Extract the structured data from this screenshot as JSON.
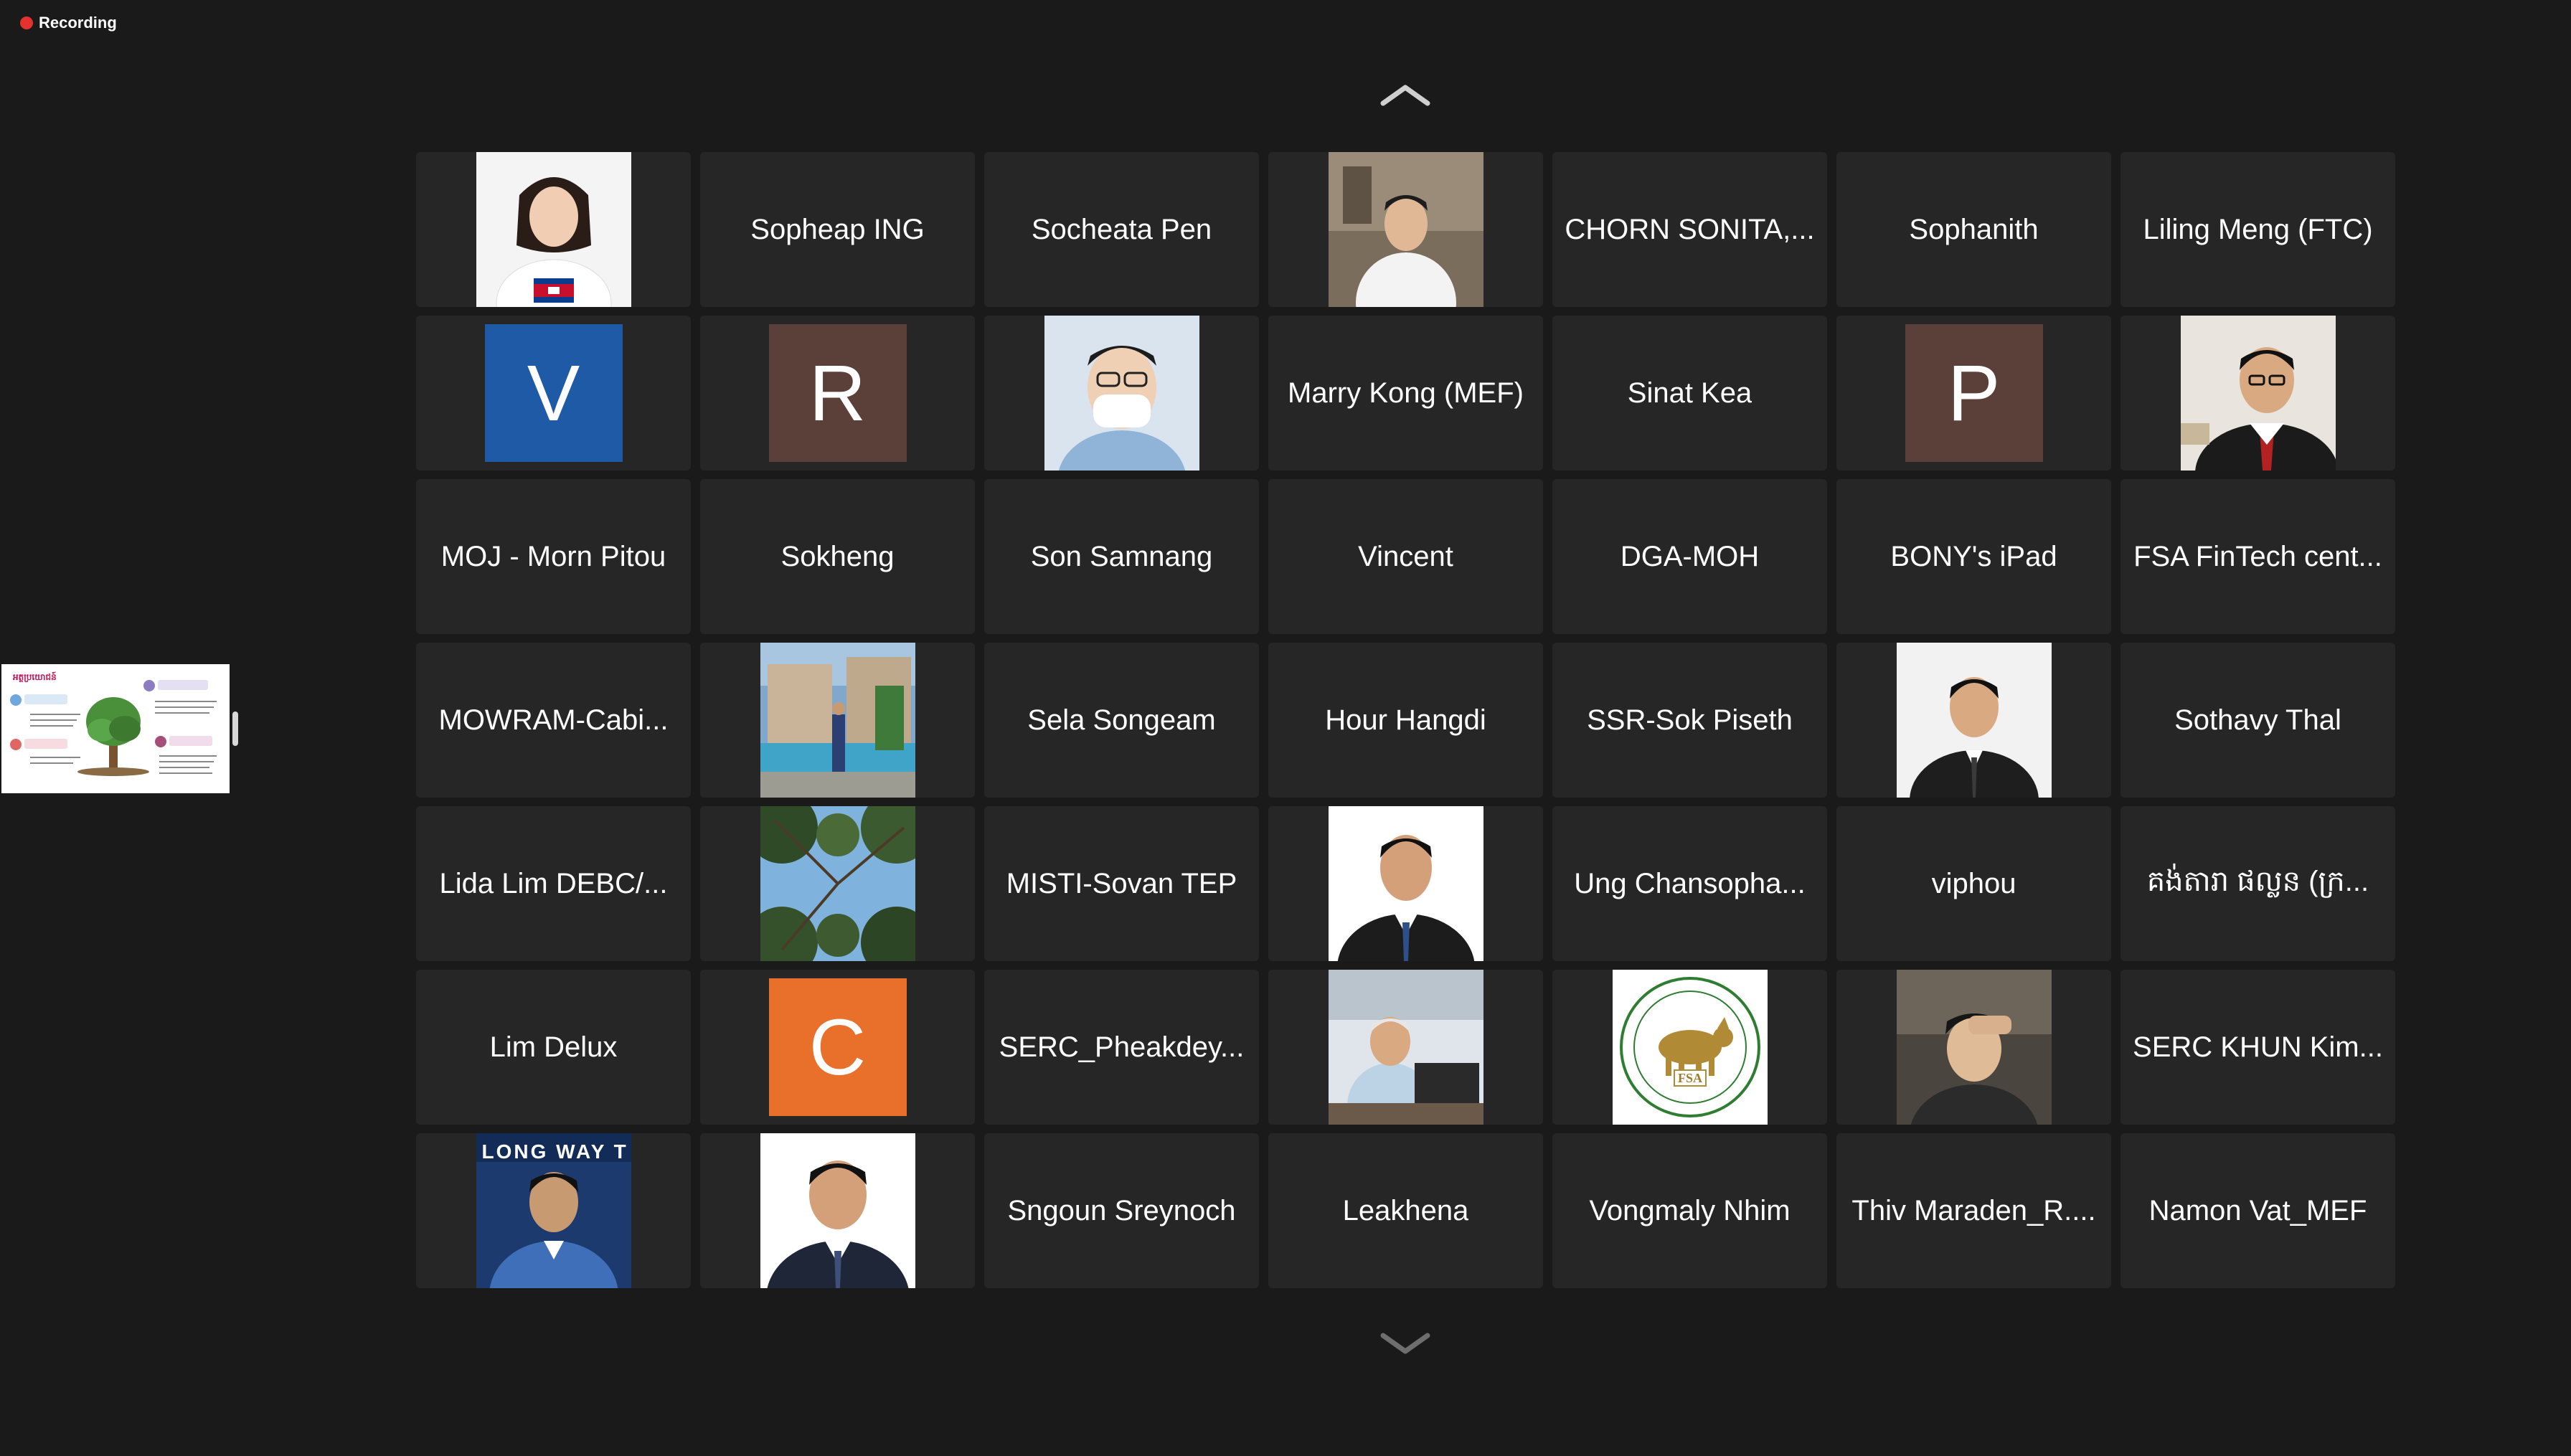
{
  "recording": {
    "label": "Recording",
    "dot_color": "#e5322d"
  },
  "navigation": {
    "up_icon": "chevron-up-icon",
    "down_icon": "chevron-down-icon"
  },
  "participants": [
    {
      "id": "p01",
      "type": "photo",
      "name": "",
      "photo": "woman-with-cambodian-flag"
    },
    {
      "id": "p02",
      "type": "name",
      "name": "Sopheap ING"
    },
    {
      "id": "p03",
      "type": "name",
      "name": "Socheata Pen"
    },
    {
      "id": "p04",
      "type": "photo",
      "name": "",
      "photo": "man-in-white-shirt"
    },
    {
      "id": "p05",
      "type": "name",
      "name": "CHORN SONITA,..."
    },
    {
      "id": "p06",
      "type": "name",
      "name": "Sophanith"
    },
    {
      "id": "p07",
      "type": "name",
      "name": "Liling Meng (FTC)"
    },
    {
      "id": "p08",
      "type": "avatar",
      "letter": "V",
      "color": "#1f5aa6"
    },
    {
      "id": "p09",
      "type": "avatar",
      "letter": "R",
      "color": "#5a4038"
    },
    {
      "id": "p10",
      "type": "photo",
      "name": "",
      "photo": "man-with-mask"
    },
    {
      "id": "p11",
      "type": "name",
      "name": "Marry Kong (MEF)"
    },
    {
      "id": "p12",
      "type": "name",
      "name": "Sinat Kea"
    },
    {
      "id": "p13",
      "type": "avatar",
      "letter": "P",
      "color": "#5a4038"
    },
    {
      "id": "p14",
      "type": "photo",
      "name": "",
      "photo": "man-with-glasses-suit"
    },
    {
      "id": "p15",
      "type": "name",
      "name": "MOJ - Morn Pitou"
    },
    {
      "id": "p16",
      "type": "name",
      "name": "Sokheng"
    },
    {
      "id": "p17",
      "type": "name",
      "name": "Son Samnang"
    },
    {
      "id": "p18",
      "type": "name",
      "name": "Vincent"
    },
    {
      "id": "p19",
      "type": "name",
      "name": "DGA-MOH"
    },
    {
      "id": "p20",
      "type": "name",
      "name": "BONY's iPad"
    },
    {
      "id": "p21",
      "type": "name",
      "name": "FSA FinTech cent..."
    },
    {
      "id": "p22",
      "type": "name",
      "name": "MOWRAM-Cabi..."
    },
    {
      "id": "p23",
      "type": "photo",
      "name": "",
      "photo": "man-by-pool"
    },
    {
      "id": "p24",
      "type": "name",
      "name": "Sela Songeam"
    },
    {
      "id": "p25",
      "type": "name",
      "name": "Hour Hangdi"
    },
    {
      "id": "p26",
      "type": "name",
      "name": "SSR-Sok Piseth"
    },
    {
      "id": "p27",
      "type": "photo",
      "name": "",
      "photo": "man-in-suit-portrait"
    },
    {
      "id": "p28",
      "type": "name",
      "name": "Sothavy Thal"
    },
    {
      "id": "p29",
      "type": "name",
      "name": "Lida Lim DEBC/..."
    },
    {
      "id": "p30",
      "type": "photo",
      "name": "",
      "photo": "tree-canopy"
    },
    {
      "id": "p31",
      "type": "name",
      "name": "MISTI-Sovan TEP"
    },
    {
      "id": "p32",
      "type": "photo",
      "name": "",
      "photo": "man-suit-blue-tie"
    },
    {
      "id": "p33",
      "type": "name",
      "name": "Ung Chansopha..."
    },
    {
      "id": "p34",
      "type": "name",
      "name": "viphou"
    },
    {
      "id": "p35",
      "type": "name",
      "name": "គង់តារា ផល្លន (ក្រ..."
    },
    {
      "id": "p36",
      "type": "name",
      "name": "Lim Delux"
    },
    {
      "id": "p37",
      "type": "avatar",
      "letter": "C",
      "color": "#e8702a"
    },
    {
      "id": "p38",
      "type": "name",
      "name": "SERC_Pheakdey..."
    },
    {
      "id": "p39",
      "type": "photo",
      "name": "",
      "photo": "man-at-desk"
    },
    {
      "id": "p40",
      "type": "photo",
      "name": "",
      "photo": "fsa-logo",
      "logo_text": "FSA"
    },
    {
      "id": "p41",
      "type": "photo",
      "name": "",
      "photo": "young-man-selfie"
    },
    {
      "id": "p42",
      "type": "name",
      "name": "SERC KHUN Kim..."
    },
    {
      "id": "p43",
      "type": "photo",
      "name": "",
      "photo": "man-blue-suit-banner",
      "banner_text": "LONG WAY T"
    },
    {
      "id": "p44",
      "type": "photo",
      "name": "",
      "photo": "man-dark-suit"
    },
    {
      "id": "p45",
      "type": "name",
      "name": "Sngoun Sreynoch"
    },
    {
      "id": "p46",
      "type": "name",
      "name": "Leakhena"
    },
    {
      "id": "p47",
      "type": "name",
      "name": "Vongmaly Nhim"
    },
    {
      "id": "p48",
      "type": "name",
      "name": "Thiv Maraden_R...."
    },
    {
      "id": "p49",
      "type": "name",
      "name": "Namon Vat_MEF"
    }
  ],
  "shared_screen_thumbnail": {
    "title": "អត្ថប្រយោជន៍"
  }
}
